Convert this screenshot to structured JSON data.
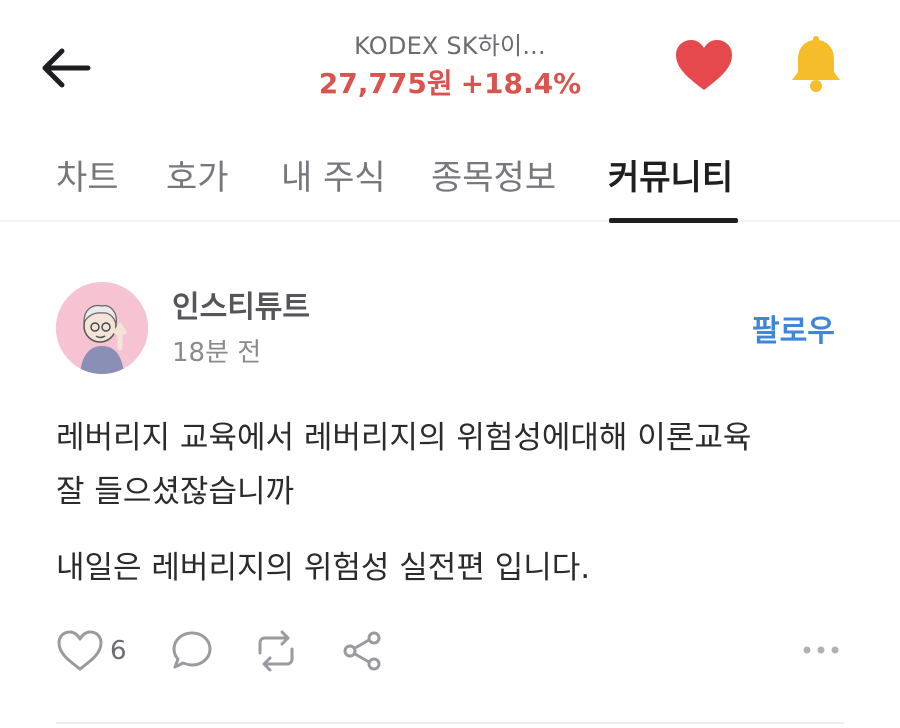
{
  "header": {
    "stock_name": "KODEX SK하이...",
    "price": "27,775원",
    "change": "+18.4%",
    "price_color": "#d9534f",
    "icons": {
      "back": "back-arrow-icon",
      "favorite": "heart-icon",
      "alert": "bell-icon"
    }
  },
  "tabs": [
    {
      "label": "차트"
    },
    {
      "label": "호가"
    },
    {
      "label": "내 주식"
    },
    {
      "label": "종목정보"
    },
    {
      "label": "커뮤니티",
      "active": true
    }
  ],
  "post": {
    "author": "인스티튜트",
    "time": "18분 전",
    "follow_label": "팔로우",
    "follow_color": "#3d86d8",
    "lines": [
      "레버리지 교육에서 레버리지의 위험성에대해 이론교육",
      "잘 들으셨잖습니까",
      "내일은 레버리지의 위험성 실전편 입니다."
    ],
    "like_count": "6",
    "icons": {
      "like": "heart-outline-icon",
      "comment": "comment-icon",
      "repost": "repost-icon",
      "share": "share-icon",
      "more": "more-dots-icon"
    }
  }
}
